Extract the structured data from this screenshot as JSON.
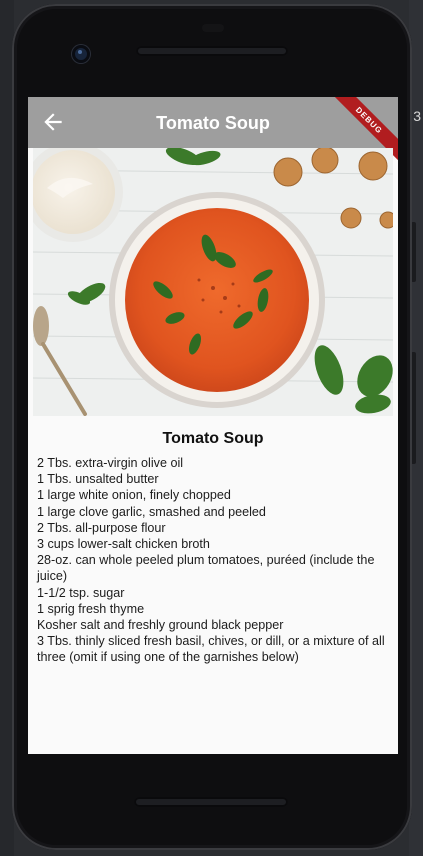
{
  "app": {
    "title": "Tomato Soup",
    "debug_banner": "DEBUG"
  },
  "icons": {
    "back": "arrow-back-icon"
  },
  "hero_image": {
    "subject": "bowl of tomato soup garnished with basil"
  },
  "recipe": {
    "title": "Tomato Soup",
    "ingredients": [
      "2 Tbs. extra-virgin olive oil",
      "1 Tbs. unsalted butter",
      "1 large white onion, finely chopped",
      "1 large clove garlic, smashed and peeled",
      "2 Tbs. all-purpose flour",
      "3 cups lower-salt chicken broth",
      "28-oz. can whole peeled plum tomatoes, puréed (include the juice)",
      "1-1/2 tsp. sugar",
      "1 sprig fresh thyme",
      "Kosher salt and freshly ground black pepper",
      "3 Tbs. thinly sliced fresh basil, chives, or dill, or a mixture of all three (omit if using one of the garnishes below)"
    ]
  },
  "backdrop": {
    "edge_char": "3"
  },
  "colors": {
    "appbar": "#9e9e9e",
    "debug_ribbon": "#b11d1f",
    "screen_bg": "#fafafa",
    "soup": "#e0541f"
  }
}
